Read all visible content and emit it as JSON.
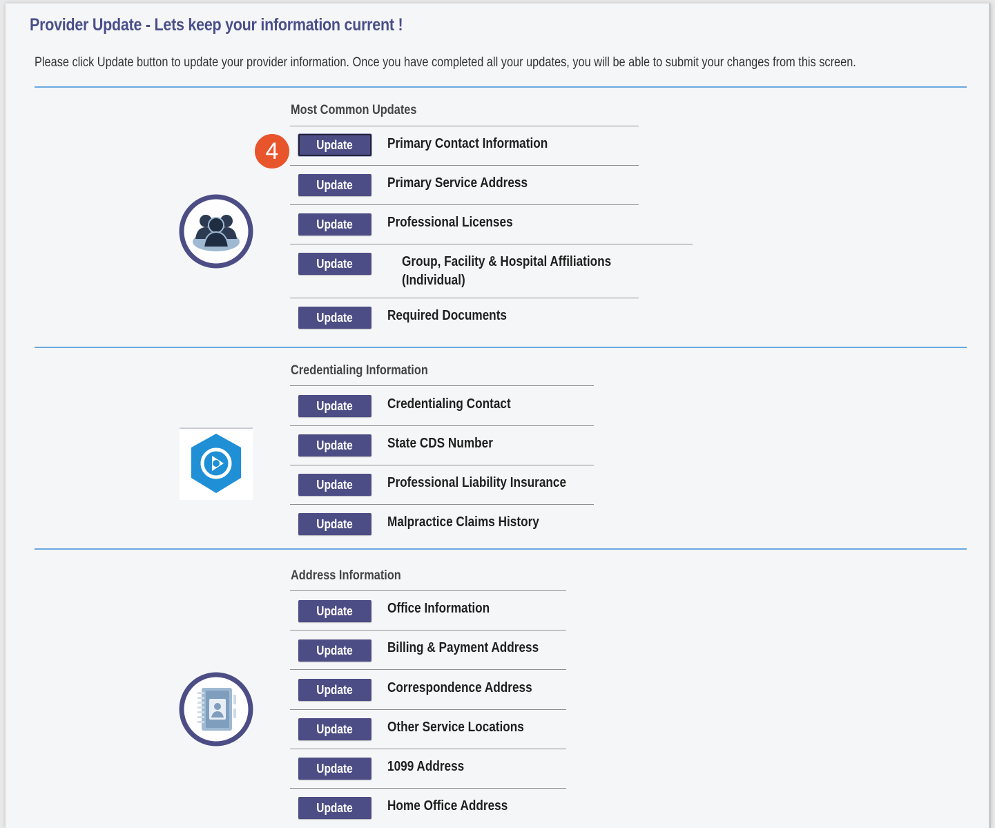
{
  "page": {
    "title": "Provider Update - Lets keep your information current !",
    "instructions": "Please click Update button to update your provider information. Once you have completed all your updates, you will be able to submit your changes from this screen."
  },
  "step_badge": "4",
  "colors": {
    "accent": "#4d4d86",
    "divider": "#6aa8df",
    "badge": "#e8542b",
    "hex_icon": "#1f8fd6"
  },
  "button_label": "Update",
  "sections": [
    {
      "title": "Most Common Updates",
      "icon": "group-icon",
      "items": [
        {
          "label": "Primary Contact Information",
          "focused": true
        },
        {
          "label": "Primary Service Address"
        },
        {
          "label": "Professional Licenses"
        },
        {
          "label": "Group, Facility & Hospital Affiliations",
          "label_line2": "(Individual)"
        },
        {
          "label": "Required Documents"
        }
      ]
    },
    {
      "title": "Credentialing Information",
      "icon": "credentialing-hexagon-icon",
      "items": [
        {
          "label": "Credentialing Contact"
        },
        {
          "label": "State CDS Number"
        },
        {
          "label": "Professional Liability Insurance"
        },
        {
          "label": "Malpractice Claims History"
        }
      ]
    },
    {
      "title": "Address Information",
      "icon": "address-book-icon",
      "items": [
        {
          "label": "Office Information"
        },
        {
          "label": "Billing & Payment Address"
        },
        {
          "label": "Correspondence Address"
        },
        {
          "label": "Other Service Locations"
        },
        {
          "label": "1099 Address"
        },
        {
          "label": "Home Office Address"
        }
      ]
    }
  ]
}
